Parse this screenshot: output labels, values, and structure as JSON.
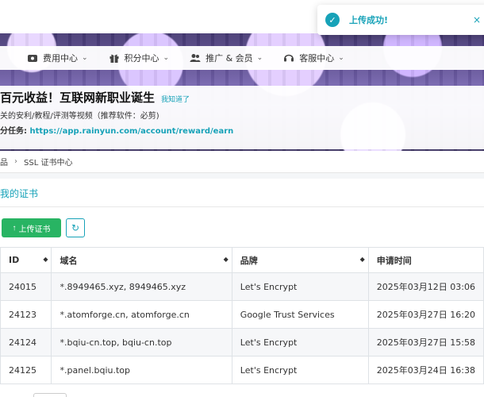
{
  "nav": {
    "items": [
      {
        "label": "费用中心",
        "icon": "wallet-icon"
      },
      {
        "label": "积分中心",
        "icon": "gift-icon"
      },
      {
        "label": "推广 & 会员",
        "icon": "users-icon"
      },
      {
        "label": "客服中心",
        "icon": "headset-icon"
      }
    ]
  },
  "notice": {
    "title": "百元收益！互联网新职业诞生",
    "tag": "我知道了",
    "line1": "关的安利/教程/评测等视频（推荐软件：必剪)",
    "line2_prefix": "分任务: ",
    "line2_link": "https://app.rainyun.com/account/reward/earn"
  },
  "breadcrumb": {
    "parent": "品",
    "current": "SSL 证书中心"
  },
  "card": {
    "title": "我的证书",
    "upload_label": "上传证书",
    "upload_icon": "↑",
    "refresh_icon": "↻"
  },
  "table": {
    "headers": [
      "ID",
      "域名",
      "品牌",
      "申请时间"
    ],
    "rows": [
      [
        "24015",
        "*.8949465.xyz, 8949465.xyz",
        "Let's Encrypt",
        "2025年03月12日 03:06"
      ],
      [
        "24123",
        "*.atomforge.cn, atomforge.cn",
        "Google Trust Services",
        "2025年03月27日 16:20"
      ],
      [
        "24124",
        "*.bqiu-cn.top, bqiu-cn.top",
        "Let's Encrypt",
        "2025年03月27日 15:58"
      ],
      [
        "24125",
        "*.panel.bqiu.top",
        "Let's Encrypt",
        "2025年03月24日 16:38"
      ]
    ]
  },
  "toast": {
    "text": "上传成功!",
    "check": "✓",
    "close": "×"
  }
}
